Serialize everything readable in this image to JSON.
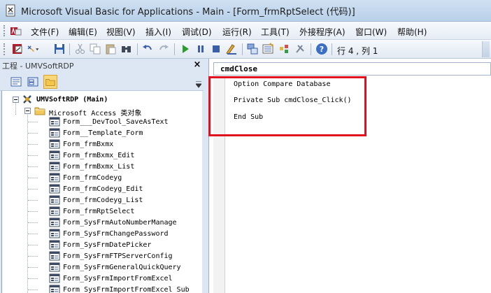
{
  "window": {
    "title": "Microsoft Visual Basic for Applications - Main - [Form_frmRptSelect (代码)]"
  },
  "menu": {
    "items": [
      {
        "label": "文件(F)"
      },
      {
        "label": "编辑(E)"
      },
      {
        "label": "视图(V)"
      },
      {
        "label": "插入(I)"
      },
      {
        "label": "调试(D)"
      },
      {
        "label": "运行(R)"
      },
      {
        "label": "工具(T)"
      },
      {
        "label": "外接程序(A)"
      },
      {
        "label": "窗口(W)"
      },
      {
        "label": "帮助(H)"
      }
    ]
  },
  "toolbar": {
    "buttons": [
      "access-view-icon",
      "insert-dropdown-icon",
      "save-icon",
      "cut-icon",
      "copy-icon",
      "paste-icon",
      "find-icon",
      "undo-icon",
      "redo-icon",
      "run-icon",
      "break-icon",
      "reset-icon",
      "design-mode-icon",
      "project-explorer-icon",
      "properties-icon",
      "object-browser-icon",
      "toolbox-icon",
      "help-icon"
    ],
    "status": "行 4 , 列 1"
  },
  "project_panel": {
    "title": "工程 - UMVSoftRDP",
    "close": "×",
    "root": "UMVSoftRDP (Main)",
    "folder": "Microsoft Access 类对象",
    "items": [
      "Form___DevTool_SaveAsText",
      "Form__Template_Form",
      "Form_frmBxmx",
      "Form_frmBxmx_Edit",
      "Form_frmBxmx_List",
      "Form_frmCodeyg",
      "Form_frmCodeyg_Edit",
      "Form_frmCodeyg_List",
      "Form_frmRptSelect",
      "Form_SysFrmAutoNumberManage",
      "Form_SysFrmChangePassword",
      "Form_SysFrmDatePicker",
      "Form_SysFrmFTPServerConfig",
      "Form_SysFrmGeneralQuickQuery",
      "Form_SysFrmImportFromExcel",
      "Form_SysFrmImportFromExcel_Sub"
    ]
  },
  "code_window": {
    "object": "cmdClose",
    "lines": [
      "Option Compare Database",
      "Private Sub cmdClose_Click()",
      "End Sub"
    ]
  },
  "colors": {
    "highlight": "#e0101c",
    "title_bar": "#c4d8ee"
  }
}
